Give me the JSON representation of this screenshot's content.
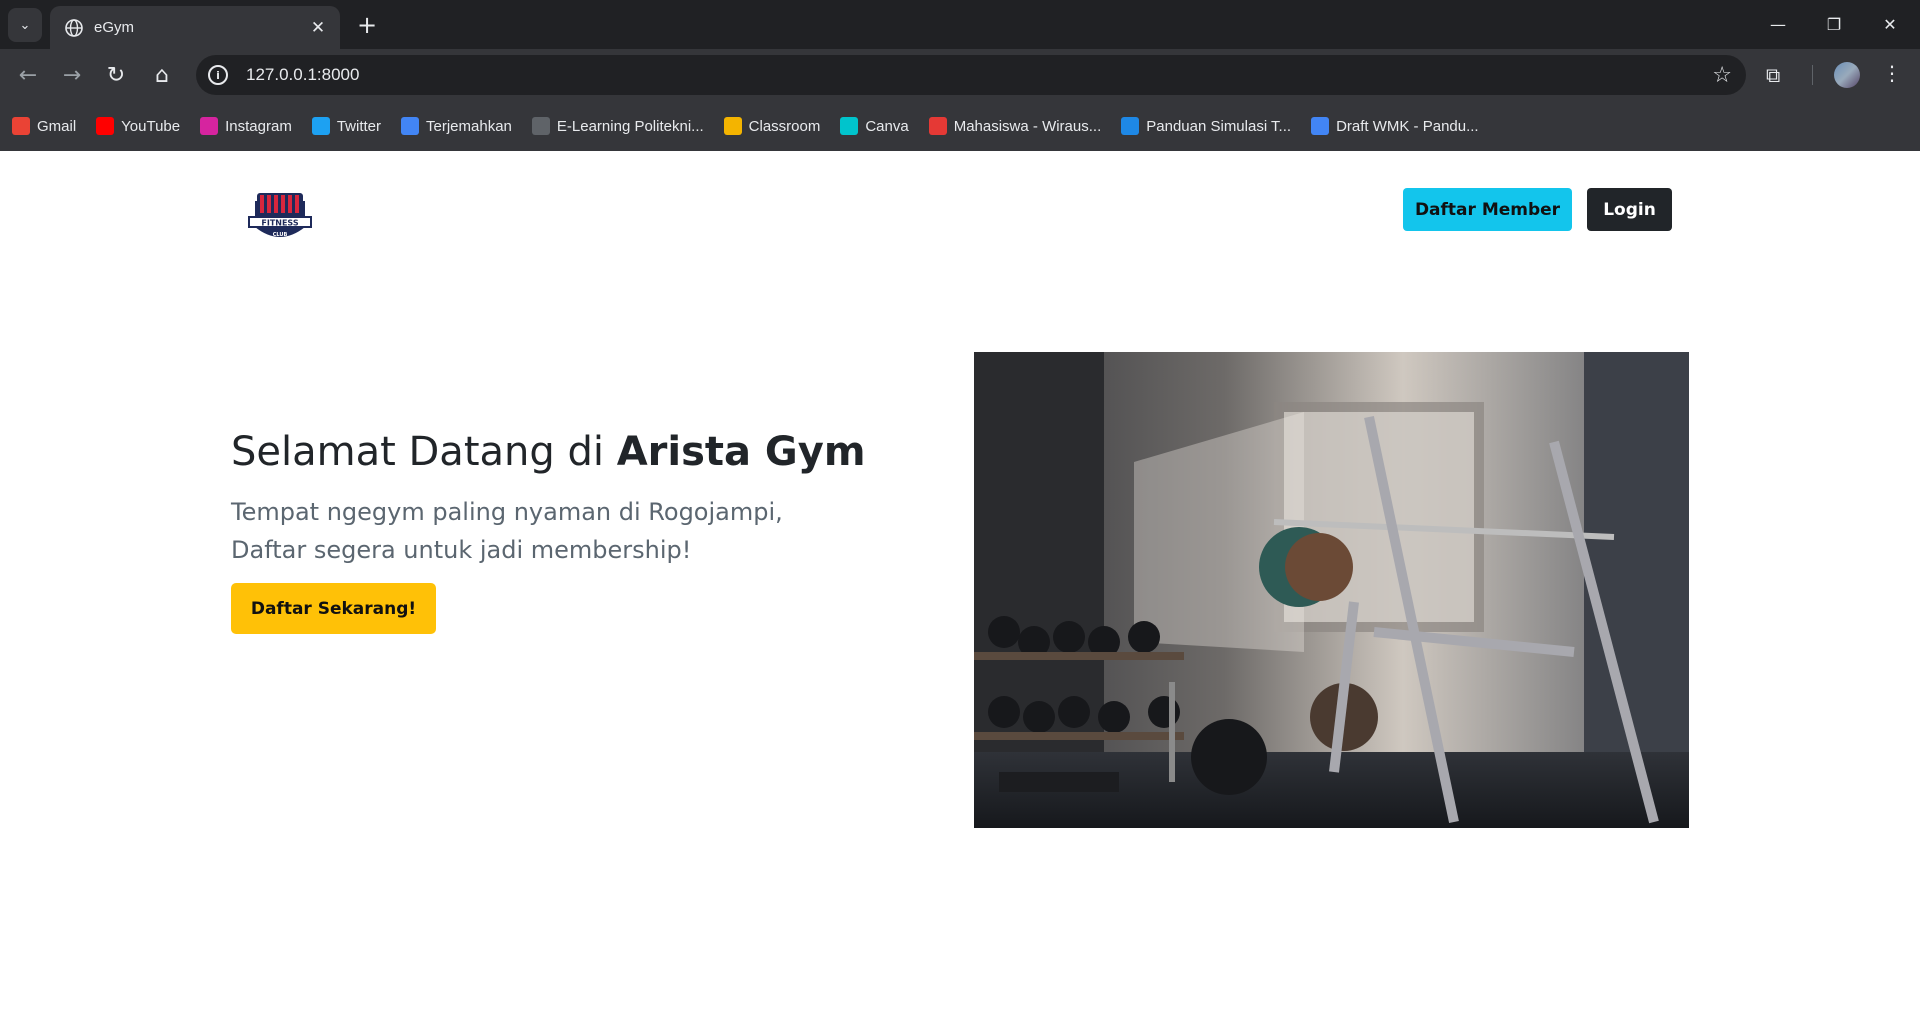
{
  "browser": {
    "tab_title": "eGym",
    "url": "127.0.0.1:8000",
    "bookmarks": [
      {
        "label": "Gmail",
        "color": "#ea4335"
      },
      {
        "label": "YouTube",
        "color": "#ff0000"
      },
      {
        "label": "Instagram",
        "color": "#d6249f"
      },
      {
        "label": "Twitter",
        "color": "#1da1f2"
      },
      {
        "label": "Terjemahkan",
        "color": "#4285f4"
      },
      {
        "label": "E-Learning Politekni...",
        "color": "#5f6368"
      },
      {
        "label": "Classroom",
        "color": "#f4b400"
      },
      {
        "label": "Canva",
        "color": "#00c4cc"
      },
      {
        "label": "Mahasiswa - Wiraus...",
        "color": "#e53935"
      },
      {
        "label": "Panduan Simulasi T...",
        "color": "#1e88e5"
      },
      {
        "label": "Draft WMK - Pandu...",
        "color": "#4285f4"
      }
    ]
  },
  "header": {
    "logo_text": "FITNESS",
    "logo_sub": "CLUB",
    "member_button": "Daftar Member",
    "login_button": "Login"
  },
  "hero": {
    "title_prefix": "Selamat Datang di ",
    "title_brand": "Arista Gym",
    "subtitle_line1": "Tempat ngegym paling nyaman di Rogojampi,",
    "subtitle_line2": "Daftar segera untuk jadi membership!",
    "cta_button": "Daftar Sekarang!"
  },
  "colors": {
    "member_button": "#13c5ec",
    "login_button": "#212529",
    "cta_button": "#ffc107"
  }
}
